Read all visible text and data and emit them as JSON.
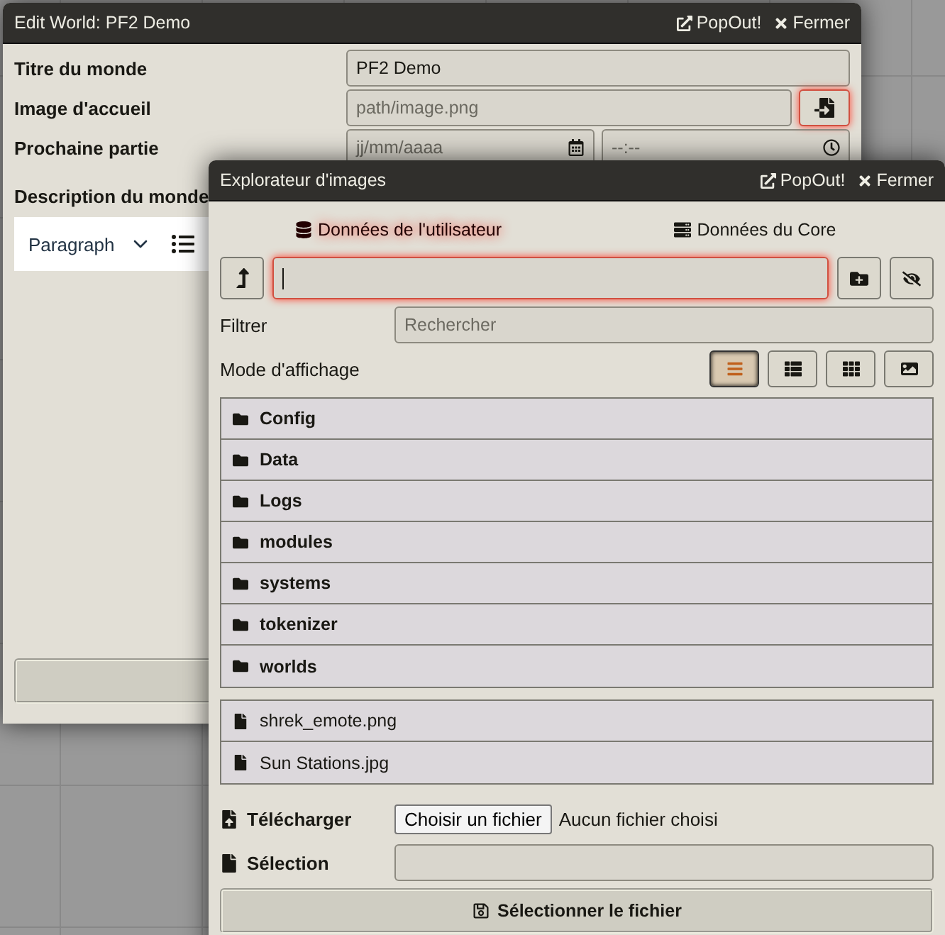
{
  "world_window": {
    "title": "Edit World: PF2 Demo",
    "popout": "PopOut!",
    "close": "Fermer",
    "fields": [
      {
        "kind": "text",
        "label": "Titre du monde",
        "value": "PF2 Demo"
      },
      {
        "kind": "file",
        "label": "Image d'accueil",
        "placeholder": "path/image.png",
        "focused": true
      },
      {
        "kind": "datetime",
        "label": "Prochaine partie",
        "date_placeholder": "jj/mm/aaaa",
        "time_placeholder": "--:--"
      },
      {
        "kind": "editor",
        "label": "Description du monde",
        "format": "Paragraph"
      }
    ]
  },
  "browser_window": {
    "title": "Explorateur d'images",
    "popout": "PopOut!",
    "close": "Fermer",
    "sources": [
      {
        "kind": "user",
        "label": "Données de l'utilisateur",
        "selected": true
      },
      {
        "kind": "core",
        "label": "Données du Core",
        "selected": false
      }
    ],
    "path_field": {
      "focused": true
    },
    "filter": {
      "label": "Filtrer",
      "placeholder": "Rechercher"
    },
    "view_mode": {
      "label": "Mode d'affichage",
      "modes": [
        {
          "kind": "list",
          "selected": true
        },
        {
          "kind": "details",
          "selected": false
        },
        {
          "kind": "tiles",
          "selected": false
        },
        {
          "kind": "thumbs",
          "selected": false
        }
      ]
    },
    "folders": [
      "Config",
      "Data",
      "Logs",
      "modules",
      "systems",
      "tokenizer",
      "worlds"
    ],
    "files": [
      "shrek_emote.png",
      "Sun Stations.jpg"
    ],
    "upload": {
      "label": "Télécharger",
      "button": "Choisir un fichier",
      "status": "Aucun fichier choisi"
    },
    "selection": {
      "label": "Sélection"
    },
    "submit": "Sélectionner le fichier"
  }
}
